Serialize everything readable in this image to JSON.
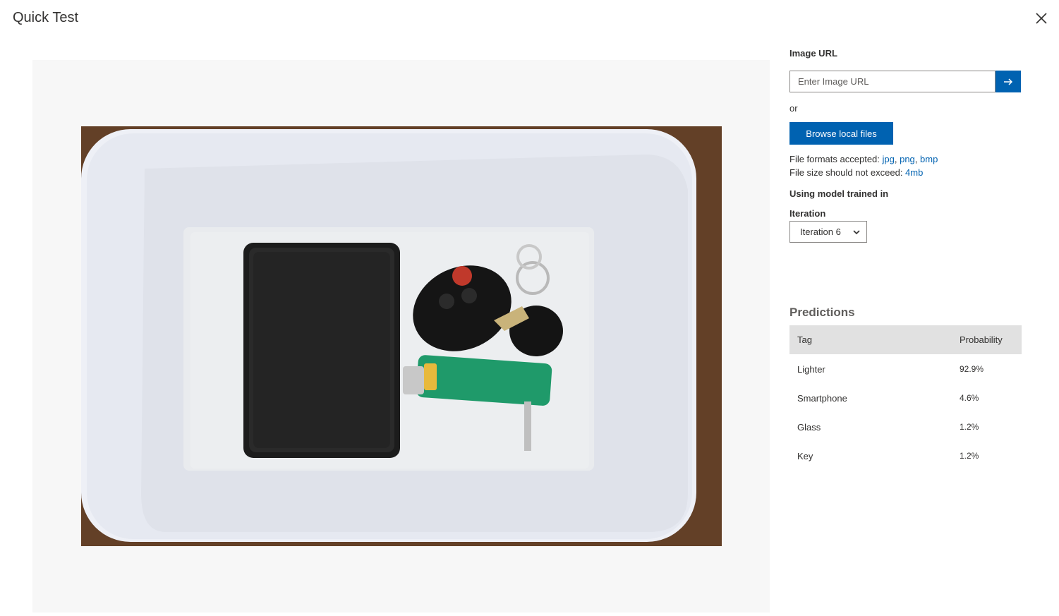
{
  "dialog": {
    "title": "Quick Test"
  },
  "image": {
    "description_icon": "photo-of-tray-with-wallet-keys-lighter"
  },
  "panel": {
    "image_url_label": "Image URL",
    "image_url_placeholder": "Enter Image URL",
    "or_text": "or",
    "browse_label": "Browse local files",
    "formats_prefix": "File formats accepted: ",
    "formats": [
      "jpg",
      "png",
      "bmp"
    ],
    "size_prefix": "File size should not exceed: ",
    "size_limit": "4mb",
    "model_label": "Using model trained in",
    "iteration_label": "Iteration",
    "iteration_value": "Iteration 6"
  },
  "predictions": {
    "title": "Predictions",
    "columns": [
      "Tag",
      "Probability"
    ],
    "rows": [
      {
        "tag": "Lighter",
        "probability": "92.9%"
      },
      {
        "tag": "Smartphone",
        "probability": "4.6%"
      },
      {
        "tag": "Glass",
        "probability": "1.2%"
      },
      {
        "tag": "Key",
        "probability": "1.2%"
      }
    ]
  },
  "colors": {
    "accent": "#0062b1",
    "header_bg": "#e1e1e1",
    "preview_bg": "#f7f7f7"
  }
}
